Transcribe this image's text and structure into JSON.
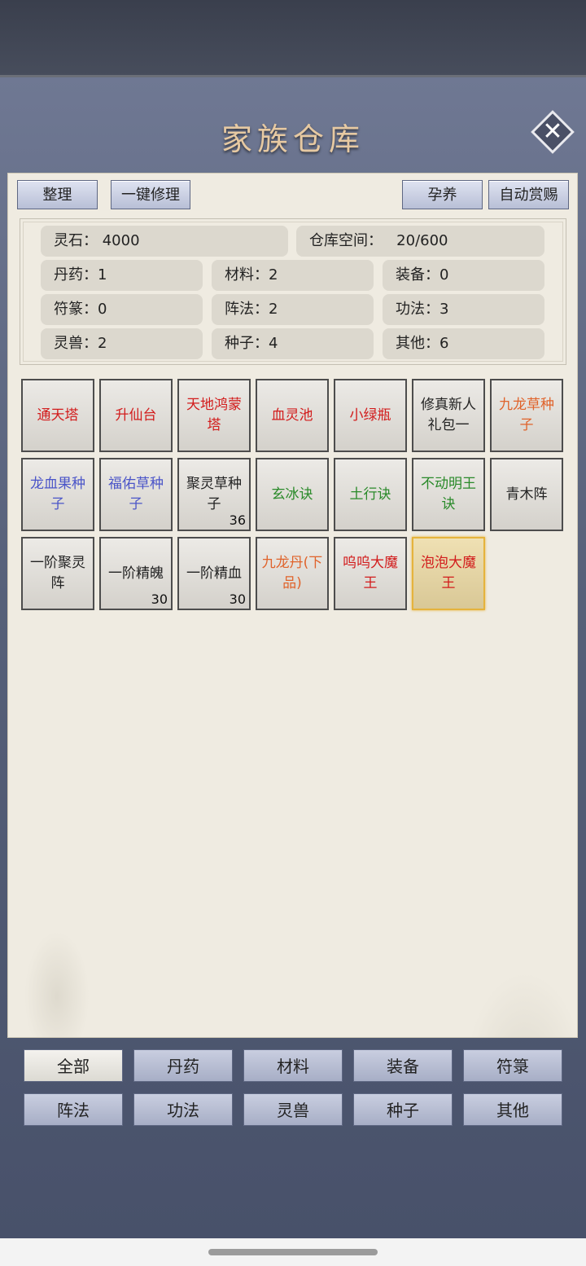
{
  "header": {
    "title": "家族仓库",
    "close_icon": "close-icon"
  },
  "toolbar": {
    "sort_label": "整理",
    "repair_label": "一键修理",
    "nurture_label": "孕养",
    "auto_reward_label": "自动赏赐"
  },
  "stats": {
    "spirit_stone": "灵石： 4000",
    "storage_space": "仓库空间：   20/600",
    "pills": "丹药：1",
    "materials": "材料：2",
    "equipment": "装备：0",
    "talismans": "符篆：0",
    "formations": "阵法：2",
    "techniques": "功法：3",
    "beasts": "灵兽：2",
    "seeds": "种子：4",
    "others": "其他：6"
  },
  "items": [
    {
      "name": "通天塔",
      "color": "red",
      "count": ""
    },
    {
      "name": "升仙台",
      "color": "red",
      "count": ""
    },
    {
      "name": "天地鸿蒙塔",
      "color": "red",
      "count": ""
    },
    {
      "name": "血灵池",
      "color": "red",
      "count": ""
    },
    {
      "name": "小绿瓶",
      "color": "red",
      "count": ""
    },
    {
      "name": "修真新人礼包一",
      "color": "black",
      "count": ""
    },
    {
      "name": "九龙草种子",
      "color": "orange",
      "count": ""
    },
    {
      "name": "龙血果种子",
      "color": "blue",
      "count": ""
    },
    {
      "name": "福佑草种子",
      "color": "blue",
      "count": ""
    },
    {
      "name": "聚灵草种子",
      "color": "black",
      "count": "36"
    },
    {
      "name": "玄冰诀",
      "color": "green",
      "count": ""
    },
    {
      "name": "土行诀",
      "color": "green",
      "count": ""
    },
    {
      "name": "不动明王诀",
      "color": "green",
      "count": ""
    },
    {
      "name": "青木阵",
      "color": "black",
      "count": ""
    },
    {
      "name": "一阶聚灵阵",
      "color": "black",
      "count": ""
    },
    {
      "name": "一阶精魄",
      "color": "black",
      "count": "30"
    },
    {
      "name": "一阶精血",
      "color": "black",
      "count": "30"
    },
    {
      "name": "九龙丹(下品)",
      "color": "orange",
      "count": ""
    },
    {
      "name": "呜呜大魔王",
      "color": "red",
      "count": ""
    },
    {
      "name": "泡泡大魔王",
      "color": "red",
      "count": "",
      "selected": true
    }
  ],
  "tabs": [
    {
      "label": "全部",
      "active": true
    },
    {
      "label": "丹药"
    },
    {
      "label": "材料"
    },
    {
      "label": "装备"
    },
    {
      "label": "符箓"
    },
    {
      "label": "阵法"
    },
    {
      "label": "功法"
    },
    {
      "label": "灵兽"
    },
    {
      "label": "种子"
    },
    {
      "label": "其他"
    }
  ]
}
